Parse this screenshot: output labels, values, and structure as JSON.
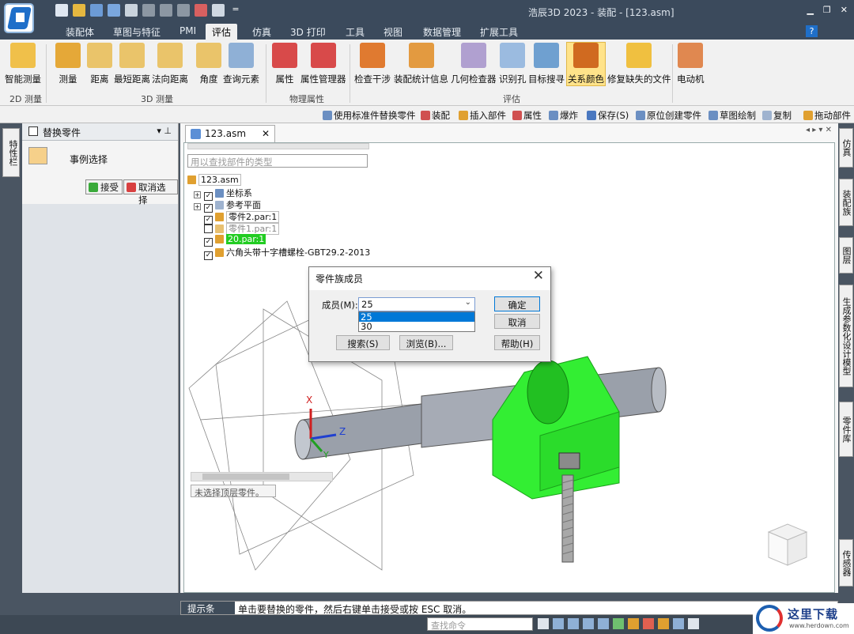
{
  "window": {
    "title": "浩辰3D 2023 - 装配 - [123.asm]"
  },
  "tabs": [
    {
      "label": "装配体"
    },
    {
      "label": "草图与特征"
    },
    {
      "label": "PMI"
    },
    {
      "label": "评估"
    },
    {
      "label": "仿真"
    },
    {
      "label": "3D 打印"
    },
    {
      "label": "工具"
    },
    {
      "label": "视图"
    },
    {
      "label": "数据管理"
    },
    {
      "label": "扩展工具"
    }
  ],
  "ribbon": {
    "buttons": [
      {
        "label": "智能测量"
      },
      {
        "label": "测量"
      },
      {
        "label": "距离"
      },
      {
        "label": "最短距离"
      },
      {
        "label": "法向距离"
      },
      {
        "label": "角度"
      },
      {
        "label": "查询元素"
      },
      {
        "label": "属性"
      },
      {
        "label": "属性管理器"
      },
      {
        "label": "检查干涉"
      },
      {
        "label": "装配统计信息"
      },
      {
        "label": "几何检查器"
      },
      {
        "label": "识别孔"
      },
      {
        "label": "目标搜寻"
      },
      {
        "label": "关系颜色"
      },
      {
        "label": "修复缺失的文件"
      },
      {
        "label": "电动机"
      }
    ],
    "groups": [
      {
        "label": "2D 测量"
      },
      {
        "label": "3D 测量"
      },
      {
        "label": "物理属性"
      },
      {
        "label": "评估"
      }
    ]
  },
  "toolbar2": [
    {
      "label": "使用标准件替换零件"
    },
    {
      "label": "装配"
    },
    {
      "label": "插入部件"
    },
    {
      "label": "属性"
    },
    {
      "label": "爆炸"
    },
    {
      "label": "保存(S)"
    },
    {
      "label": "原位创建零件"
    },
    {
      "label": "草图绘制"
    },
    {
      "label": "复制"
    },
    {
      "label": "拖动部件"
    }
  ],
  "left_vtab": "特性栏",
  "panel": {
    "title": "替换零件",
    "instance_label": "事例选择",
    "accept": "接受",
    "cancel_select": "取消选择"
  },
  "document_tab": "123.asm",
  "tree": {
    "search_placeholder": "用以查找部件的类型",
    "root": "123.asm",
    "items": [
      {
        "label": "坐标系"
      },
      {
        "label": "参考平面"
      },
      {
        "label": "零件2.par:1"
      },
      {
        "label": "零件1.par:1"
      },
      {
        "label": "20.par:1"
      },
      {
        "label": "六角头带十字槽螺栓-GBT29.2-2013"
      }
    ]
  },
  "hint": "未选择顶层零件。",
  "dialog": {
    "title": "零件族成员",
    "member_label": "成员(M):",
    "selected": "25",
    "options": [
      "25",
      "30"
    ],
    "ok": "确定",
    "cancel": "取消",
    "search": "搜索(S)",
    "browse": "浏览(B)...",
    "help": "帮助(H)"
  },
  "right_tabs": [
    {
      "label": "仿真"
    },
    {
      "label": "装配族"
    },
    {
      "label": "图层"
    },
    {
      "label": "生成参数化设计模型"
    },
    {
      "label": "零件库"
    },
    {
      "label": "传感器"
    }
  ],
  "statusbar": {
    "label": "提示条",
    "text": "单击要替换的零件，然后右键单击接受或按 ESC 取消。"
  },
  "command_placeholder": "查找命令",
  "watermark": {
    "text": "这里下载",
    "url": "www.herdown.com"
  },
  "axes": {
    "x": "X",
    "y": "Y",
    "z": "Z"
  },
  "colors": {
    "accent": "#1f6fc9",
    "highlight_part": "#33ee33",
    "title_bg": "#3b4a5c"
  }
}
